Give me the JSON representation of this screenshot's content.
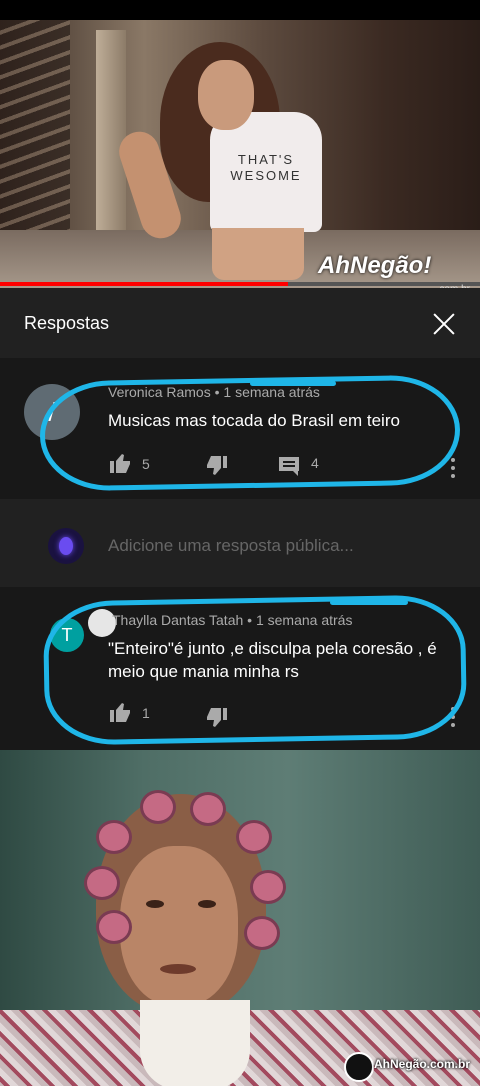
{
  "video": {
    "shirt_text_line1": "THAT'S",
    "shirt_text_line2": "WESOME",
    "progress_fraction": 0.6,
    "watermark_logo": "AhNegão!",
    "watermark_domain": ".com.br"
  },
  "replies_panel": {
    "title": "Respostas",
    "close_icon": "close-icon"
  },
  "comment_main": {
    "avatar_letter": "/",
    "author_meta": "Veronica Ramos • 1 semana atrás",
    "text": "Musicas mas tocada do Brasil  em teiro",
    "likes": "5",
    "replies": "4",
    "icons": [
      "thumbs-up-icon",
      "thumbs-down-icon",
      "reply-icon",
      "more-icon"
    ]
  },
  "add_reply": {
    "placeholder": "Adicione uma resposta pública..."
  },
  "comment_reply": {
    "avatar_letter": "T",
    "author_meta": "Thaylla Dantas Tatah • 1 semana atrás",
    "text": "\"Enteiro\"é junto ,e disculpa pela coresão , é meio que mania minha rs",
    "likes": "1"
  },
  "bottom_watermark": {
    "text": "AhNegão.com.br"
  },
  "colors": {
    "annotation": "#1fb6e8",
    "panel_bg": "#212121",
    "comment_bg": "#181818"
  }
}
